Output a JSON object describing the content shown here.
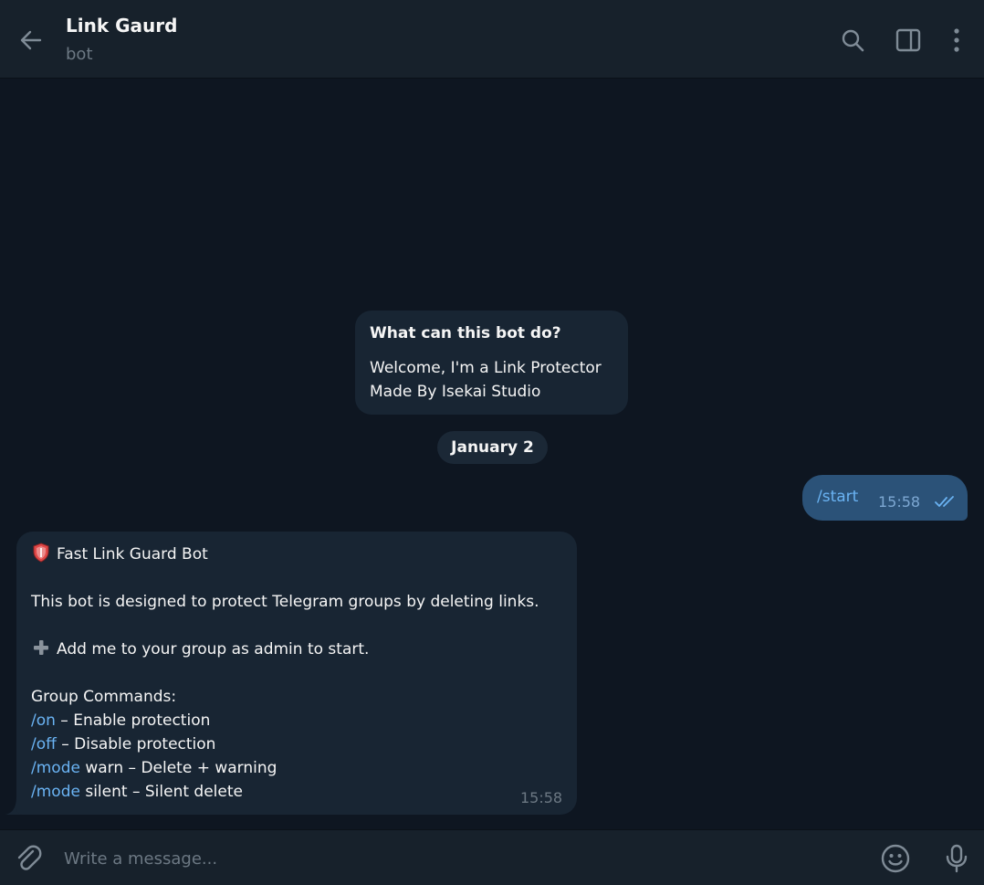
{
  "header": {
    "title": "Link Gaurd",
    "subtitle": "bot"
  },
  "icons": {
    "back": "arrow-left-icon",
    "search": "search-icon",
    "sidebar": "sidebar-toggle-icon",
    "more": "more-vertical-icon",
    "attach": "paperclip-icon",
    "emoji": "smiley-icon",
    "mic": "microphone-icon"
  },
  "intro_card": {
    "title": "What can this bot do?",
    "lines": [
      "Welcome, I'm a Link Protector",
      "Made By Isekai Studio"
    ]
  },
  "date_separator": "January 2",
  "outgoing": {
    "text": "/start",
    "time": "15:58",
    "status": "read"
  },
  "incoming": {
    "heading": "Fast Link Guard Bot",
    "description": "This bot is designed to protect Telegram groups by deleting links.",
    "add_line": "Add me to your group as admin to start.",
    "commands_title": "Group Commands:",
    "commands": [
      {
        "cmd": "/on",
        "desc": " – Enable protection"
      },
      {
        "cmd": "/off",
        "desc": " – Disable protection"
      },
      {
        "cmd": "/mode",
        "desc": " warn – Delete + warning"
      },
      {
        "cmd": "/mode",
        "desc": " silent – Silent delete"
      }
    ],
    "time": "15:58"
  },
  "composer": {
    "placeholder": "Write a message..."
  },
  "colors": {
    "background": "#0e1621",
    "panel": "#17212b",
    "incoming_bubble": "#182533",
    "outgoing_bubble": "#2b5278",
    "link": "#6ab3f3",
    "muted": "#6c7883"
  }
}
